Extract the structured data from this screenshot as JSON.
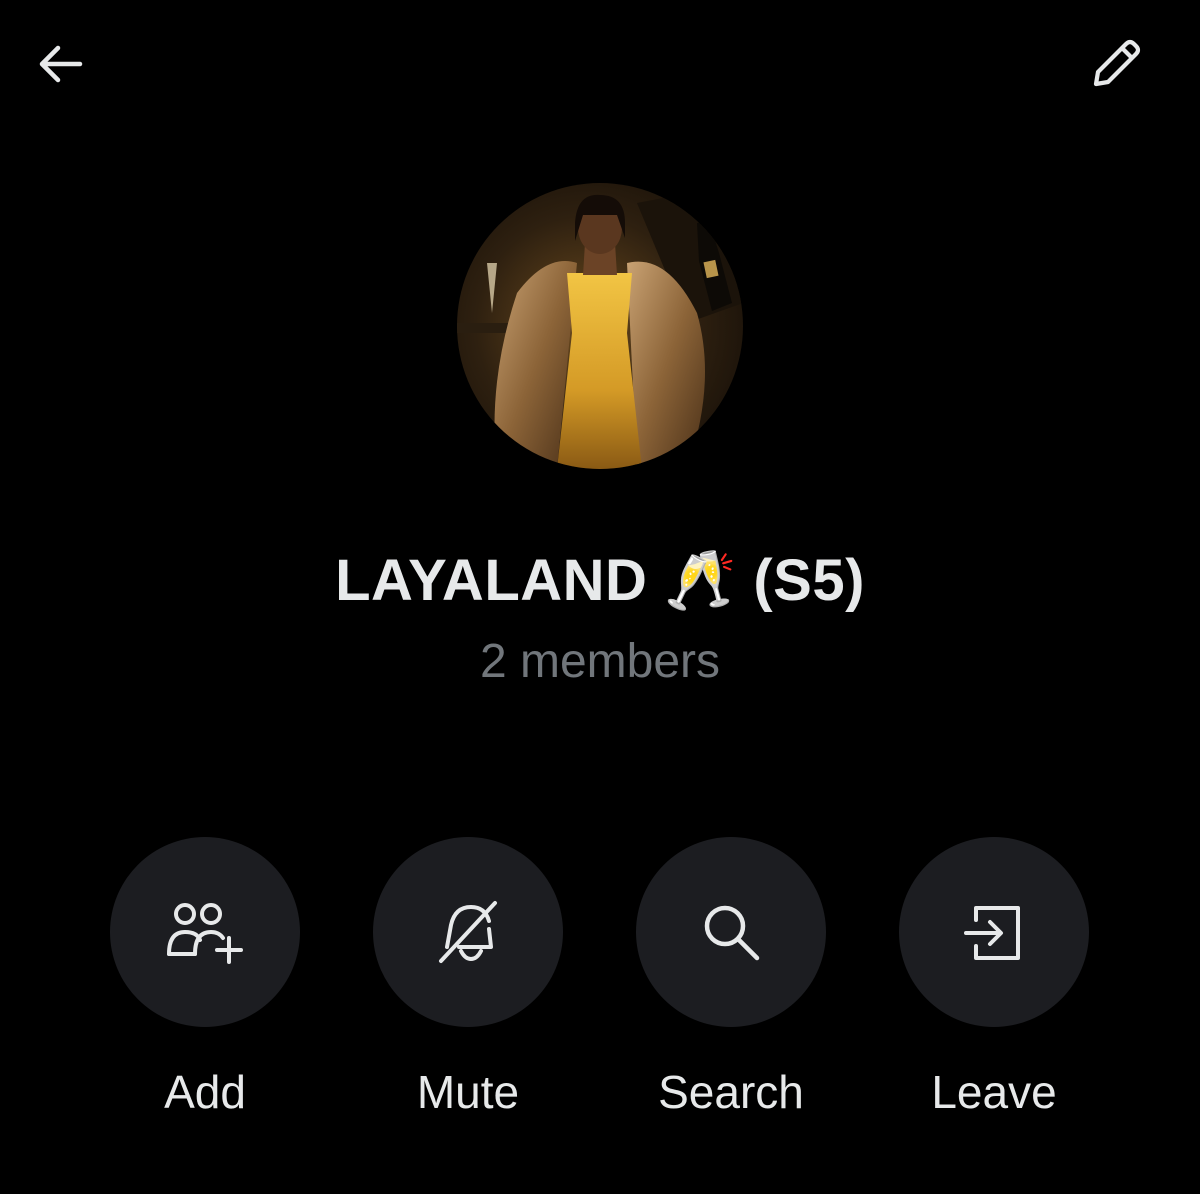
{
  "header": {
    "back_icon": "arrow-left-icon",
    "edit_icon": "pencil-icon"
  },
  "group": {
    "name": "LAYALAND 🥂 (S5)",
    "member_count": "2 members",
    "avatar": "group-avatar-photo"
  },
  "actions": [
    {
      "label": "Add",
      "icon": "add-people-icon"
    },
    {
      "label": "Mute",
      "icon": "bell-off-icon"
    },
    {
      "label": "Search",
      "icon": "search-icon"
    },
    {
      "label": "Leave",
      "icon": "leave-icon"
    }
  ],
  "colors": {
    "background": "#000000",
    "primary_text": "#e7e9ea",
    "secondary_text": "#71767b",
    "button_bg": "#1c1d21",
    "icon": "#e7e9ea"
  }
}
